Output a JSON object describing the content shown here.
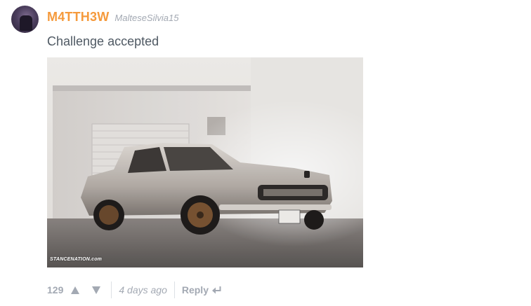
{
  "comment": {
    "username": "M4TTH3W",
    "handle": "MalteseSilvia15",
    "text": "Challenge accepted",
    "image_watermark": "STANCENATION.com",
    "votes": "129",
    "timestamp": "4 days ago",
    "reply_label": "Reply"
  },
  "icons": {
    "upvote": "triangle-up-icon",
    "downvote": "triangle-down-icon",
    "reply": "reply-arrow-icon"
  },
  "colors": {
    "username": "#f59a3c",
    "meta": "#a3a9b3",
    "body_text": "#4f5963"
  }
}
